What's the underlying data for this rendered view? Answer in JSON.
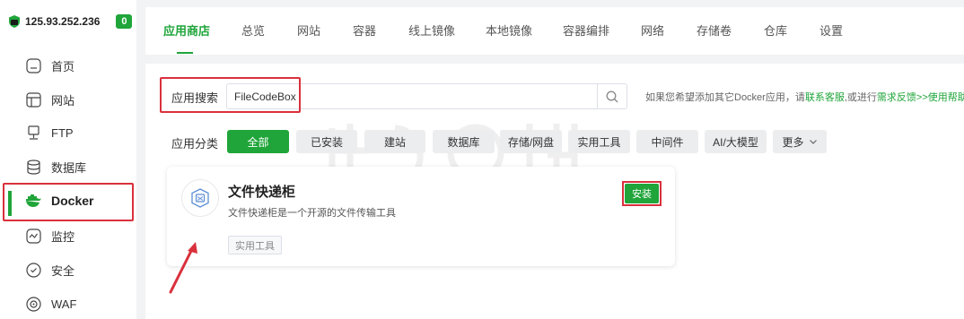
{
  "server": {
    "ip": "125.93.252.236",
    "badge": "0"
  },
  "sidebar": {
    "items": [
      {
        "label": "首页",
        "icon": "home-icon"
      },
      {
        "label": "网站",
        "icon": "website-icon"
      },
      {
        "label": "FTP",
        "icon": "ftp-icon"
      },
      {
        "label": "数据库",
        "icon": "database-icon"
      },
      {
        "label": "Docker",
        "icon": "docker-icon"
      },
      {
        "label": "监控",
        "icon": "monitor-icon"
      },
      {
        "label": "安全",
        "icon": "security-icon"
      },
      {
        "label": "WAF",
        "icon": "waf-icon"
      }
    ],
    "active": "Docker"
  },
  "tabs": [
    "应用商店",
    "总览",
    "网站",
    "容器",
    "线上镜像",
    "本地镜像",
    "容器编排",
    "网络",
    "存储卷",
    "仓库",
    "设置"
  ],
  "search": {
    "label": "应用搜索",
    "value": "FileCodeBox",
    "help_prefix": "如果您希望添加其它Docker应用，请",
    "help_link1": "联系客服",
    "help_mid": ",或进行",
    "help_link2": "需求反馈",
    "help_link3": ">>使用帮助"
  },
  "categories": {
    "label": "应用分类",
    "items": [
      "全部",
      "已安装",
      "建站",
      "数据库",
      "存储/网盘",
      "实用工具",
      "中间件",
      "AI/大模型",
      "更多"
    ],
    "active": "全部"
  },
  "app": {
    "title": "文件快递柜",
    "description": "文件快递柜是一个开源的文件传输工具",
    "tag": "实用工具",
    "install_label": "安装"
  },
  "colors": {
    "accent": "#20a53a",
    "highlight": "#d9303c"
  }
}
